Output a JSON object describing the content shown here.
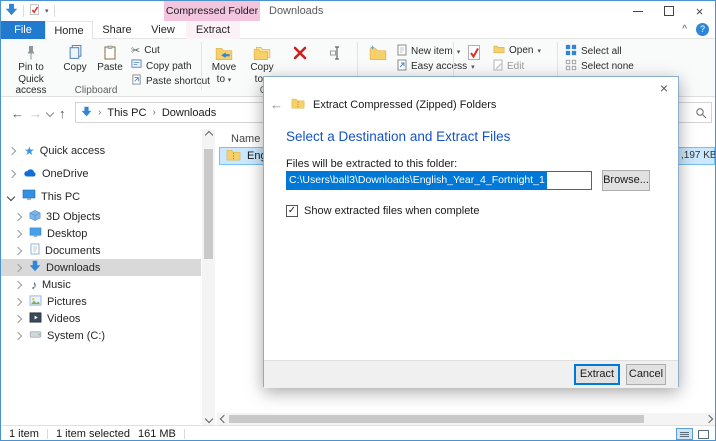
{
  "titlebar": {
    "contextual_tab": "Compressed Folder Tools",
    "title": "Downloads"
  },
  "tabs": {
    "file": "File",
    "home": "Home",
    "share": "Share",
    "view": "View",
    "extract": "Extract"
  },
  "ribbon": {
    "pin": "Pin to Quick access",
    "copy": "Copy",
    "paste": "Paste",
    "cut": "Cut",
    "copy_path": "Copy path",
    "paste_shortcut": "Paste shortcut",
    "clipboard_group": "Clipboard",
    "move_to": "Move to",
    "copy_to": "Copy to",
    "organize_group": "Organize",
    "new_item": "New item",
    "easy_access": "Easy access",
    "open": "Open",
    "edit": "Edit",
    "select_all": "Select all",
    "select_none": "Select none"
  },
  "navbar": {
    "crumb_root": "This PC",
    "crumb_current": "Downloads"
  },
  "sidebar": {
    "items": [
      {
        "label": "Quick access"
      },
      {
        "label": "OneDrive"
      },
      {
        "label": "This PC"
      },
      {
        "label": "3D Objects"
      },
      {
        "label": "Desktop"
      },
      {
        "label": "Documents"
      },
      {
        "label": "Downloads"
      },
      {
        "label": "Music"
      },
      {
        "label": "Pictures"
      },
      {
        "label": "Videos"
      },
      {
        "label": "System (C:)"
      }
    ]
  },
  "filelist": {
    "name_header": "Name",
    "file_name": "English_Year_4_Fortnight_1",
    "size_fragment": ",197 KB"
  },
  "statusbar": {
    "count": "1 item",
    "selected": "1 item selected",
    "size": "161 MB"
  },
  "dialog": {
    "title": "Extract Compressed (Zipped) Folders",
    "heading": "Select a Destination and Extract Files",
    "field_label": "Files will be extracted to this folder:",
    "path": "C:\\Users\\ball3\\Downloads\\English_Year_4_Fortnight_1",
    "browse": "Browse...",
    "checkbox": "Show extracted files when complete",
    "extract": "Extract",
    "cancel": "Cancel"
  },
  "colors": {
    "accent": "#0078d7",
    "contextual_pink": "#f3c5de",
    "heading_blue": "#1552c8",
    "selection_blue": "#cce8ff",
    "folder_yellow": "#f7d069"
  }
}
